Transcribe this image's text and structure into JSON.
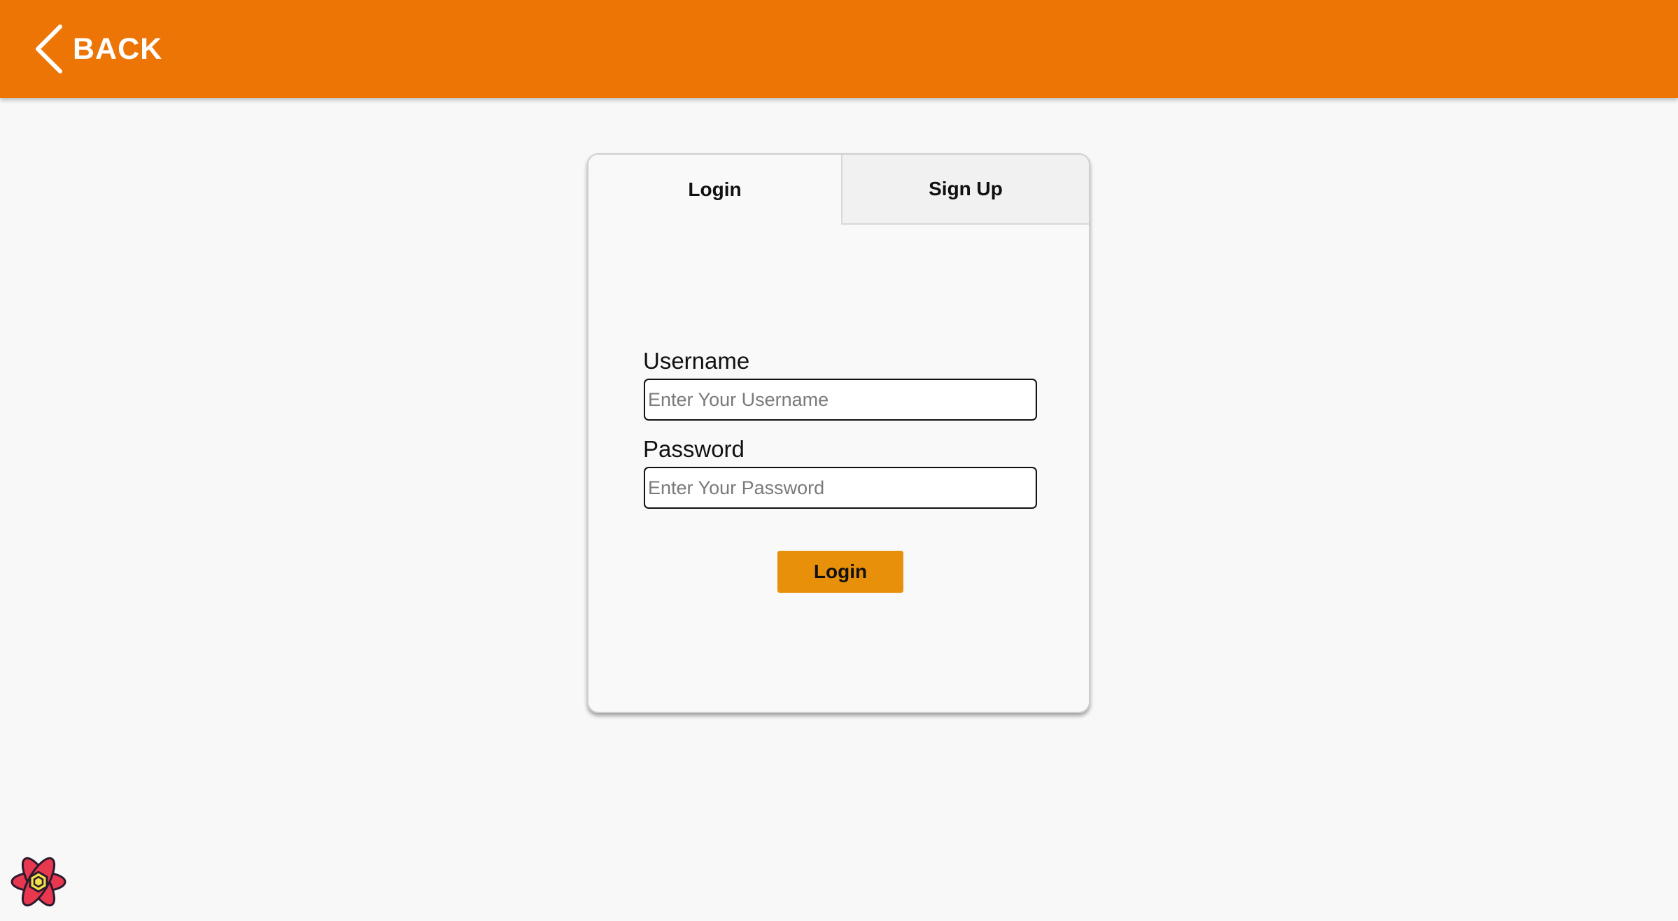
{
  "header": {
    "back_label": "BACK",
    "back_icon": "chevron-left-icon",
    "background_color": "#ec7505"
  },
  "auth_card": {
    "tabs": [
      {
        "label": "Login",
        "active": true
      },
      {
        "label": "Sign Up",
        "active": false
      }
    ],
    "username": {
      "label": "Username",
      "placeholder": "Enter Your Username",
      "value": ""
    },
    "password": {
      "label": "Password",
      "placeholder": "Enter Your Password",
      "value": ""
    },
    "submit_label": "Login",
    "submit_color": "#e8900a"
  },
  "devtools": {
    "icon": "react-devtools-icon"
  }
}
